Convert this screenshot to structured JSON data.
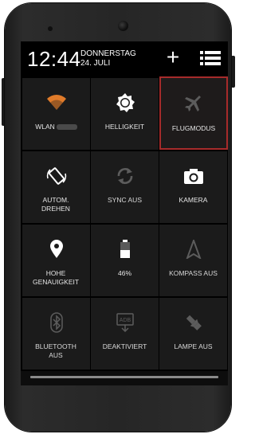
{
  "status": {
    "time": "12:44",
    "day": "DONNERSTAG",
    "date": "24. JULI"
  },
  "header": {
    "add_icon": "+"
  },
  "tiles": [
    {
      "label": "WLAN",
      "icon": "wifi-icon"
    },
    {
      "label": "HELLIGKEIT",
      "icon": "brightness-icon"
    },
    {
      "label": "FLUGMODUS",
      "icon": "airplane-icon"
    },
    {
      "label": "AUTOM. DREHEN",
      "icon": "rotate-icon"
    },
    {
      "label": "SYNC AUS",
      "icon": "sync-icon"
    },
    {
      "label": "KAMERA",
      "icon": "camera-icon"
    },
    {
      "label": "HOHE GENAUIGKEIT",
      "icon": "location-icon"
    },
    {
      "label": "46%",
      "icon": "battery-icon"
    },
    {
      "label": "KOMPASS AUS",
      "icon": "compass-icon"
    },
    {
      "label": "BLUETOOTH AUS",
      "icon": "bluetooth-icon"
    },
    {
      "label": "DEAKTIVIERT",
      "icon": "adb-icon"
    },
    {
      "label": "LAMPE AUS",
      "icon": "flashlight-icon"
    }
  ],
  "colors": {
    "wifi": "#e07b2a",
    "highlight": "#a72b2b"
  }
}
